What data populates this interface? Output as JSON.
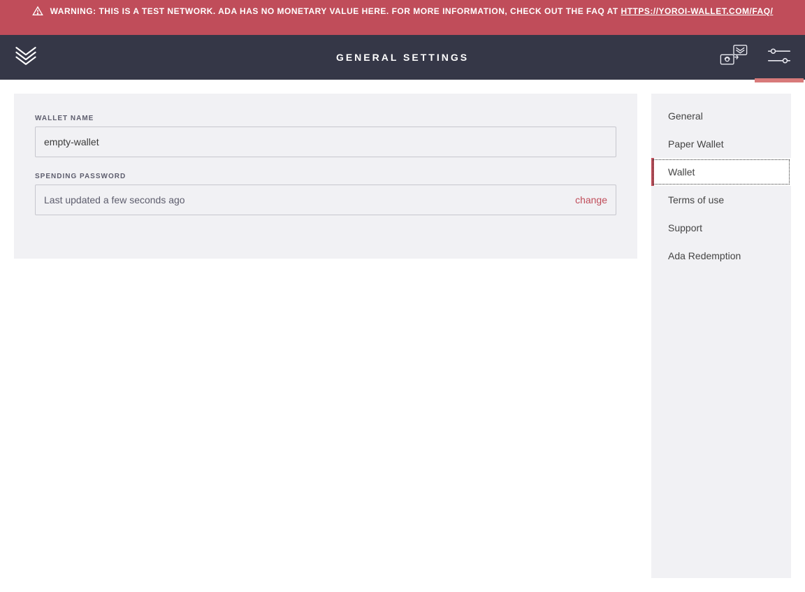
{
  "warning": {
    "prefix": "WARNING:",
    "body": " THIS IS A TEST NETWORK. ADA HAS NO MONETARY VALUE HERE. FOR MORE INFORMATION, CHECK OUT THE FAQ AT ",
    "link_text": "HTTPS://YOROI-WALLET.COM/FAQ/"
  },
  "topbar": {
    "title": "GENERAL SETTINGS"
  },
  "form": {
    "wallet_name_label": "WALLET NAME",
    "wallet_name_value": "empty-wallet",
    "spending_password_label": "SPENDING PASSWORD",
    "spending_password_status": "Last updated a few seconds ago",
    "change_label": "change"
  },
  "sidebar": {
    "items": [
      {
        "label": "General",
        "active": false
      },
      {
        "label": "Paper Wallet",
        "active": false
      },
      {
        "label": "Wallet",
        "active": true
      },
      {
        "label": "Terms of use",
        "active": false
      },
      {
        "label": "Support",
        "active": false
      },
      {
        "label": "Ada Redemption",
        "active": false
      }
    ]
  }
}
